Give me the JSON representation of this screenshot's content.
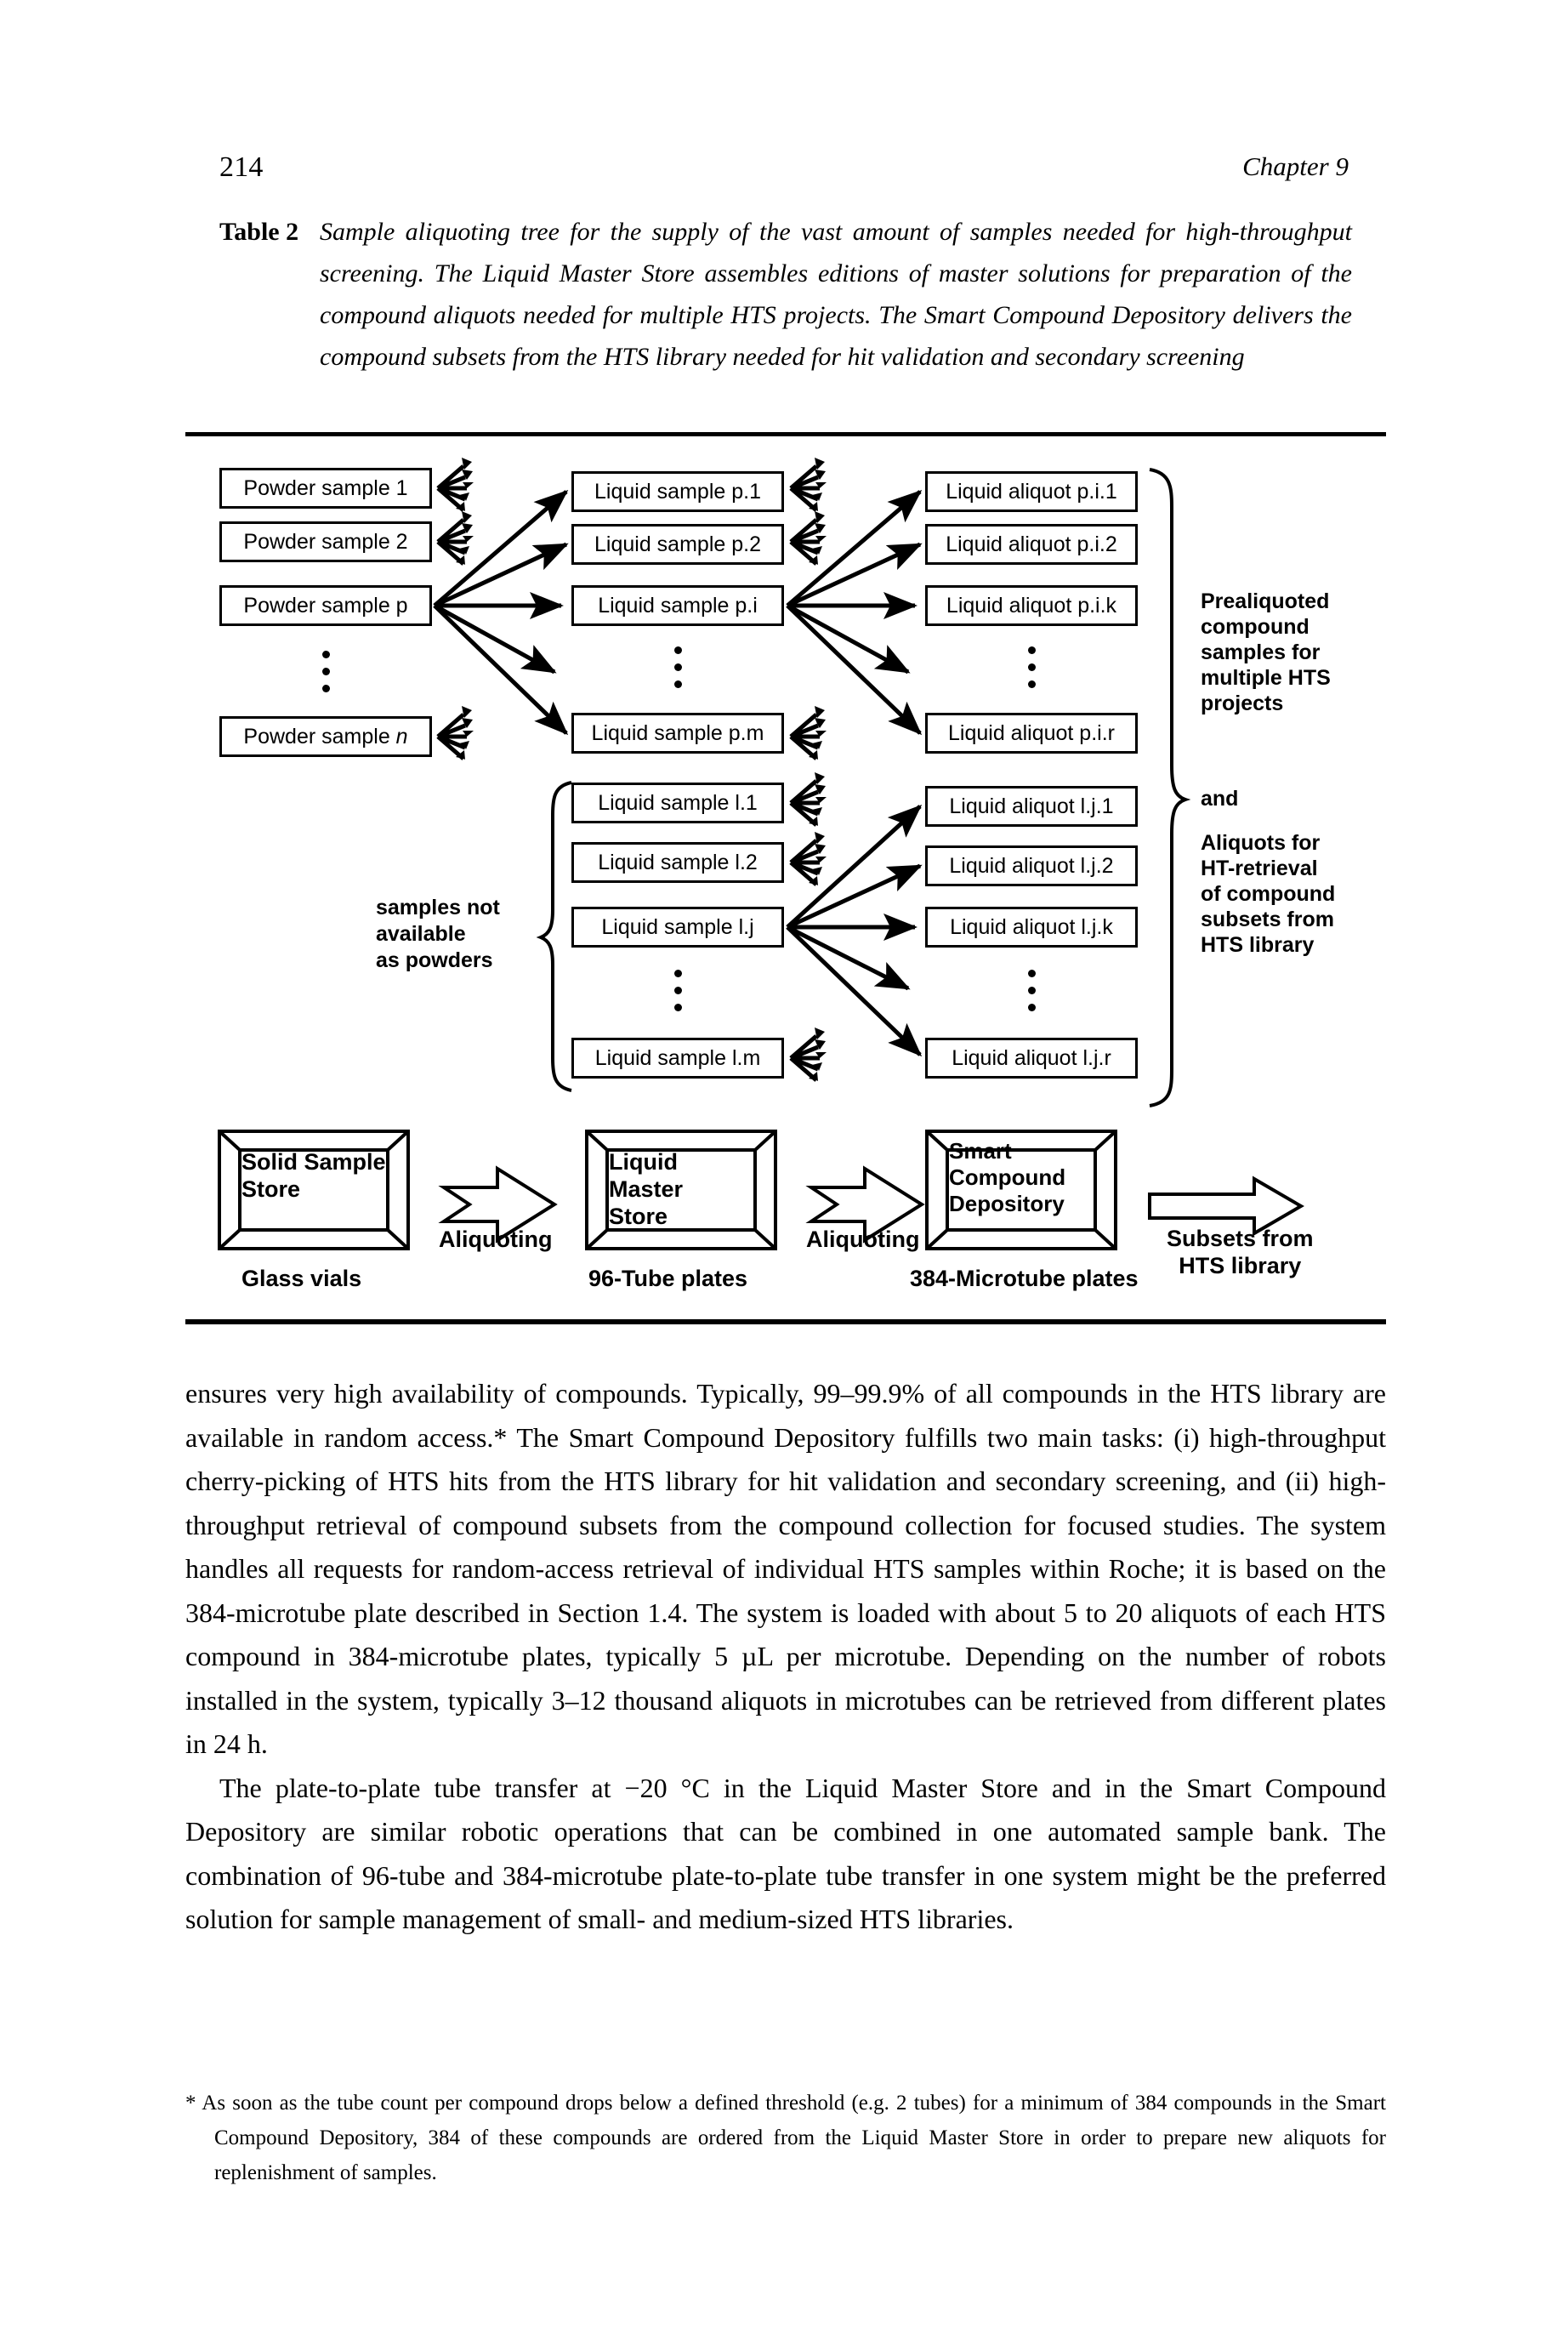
{
  "header": {
    "folio": "214",
    "chapter": "Chapter 9"
  },
  "caption": {
    "label": "Table 2",
    "text": "Sample aliquoting tree for the supply of the vast amount of samples needed for high-throughput screening. The Liquid Master Store assembles editions of master solutions for preparation of the compound aliquots needed for multiple HTS projects. The Smart Compound Depository delivers the compound subsets from the HTS library needed for hit validation and secondary screening"
  },
  "diagram": {
    "column1": {
      "nodes": [
        "Powder sample 1",
        "Powder sample 2",
        "Powder sample p",
        "Powder sample n"
      ],
      "italic_suffix_last": "n"
    },
    "column2_upper": [
      "Liquid sample p.1",
      "Liquid sample p.2",
      "Liquid sample p.i",
      "Liquid sample p.m"
    ],
    "column2_lower": [
      "Liquid sample l.1",
      "Liquid sample l.2",
      "Liquid sample l.j",
      "Liquid sample l.m"
    ],
    "column3_upper": [
      "Liquid aliquot p.i.1",
      "Liquid aliquot p.i.2",
      "Liquid aliquot p.i.k",
      "Liquid aliquot p.i.r"
    ],
    "column3_lower": [
      "Liquid aliquot l.j.1",
      "Liquid aliquot l.j.2",
      "Liquid aliquot l.j.k",
      "Liquid aliquot l.j.r"
    ],
    "annotation_right_top": "Prealiquoted\ncompound\nsamples for\nmultiple HTS\nprojects",
    "annotation_right_and": "and",
    "annotation_right_bottom": "Aliquots for\nHT-retrieval\nof compound\nsubsets from\nHTS library",
    "annotation_left": "samples not\navailable\nas powders"
  },
  "workflow": {
    "stores": [
      {
        "title": "Solid Sample\nStore",
        "caption": "Glass vials"
      },
      {
        "title": "Liquid Master\nStore",
        "caption": "96-Tube plates"
      },
      {
        "title": "Smart\nCompound\nDepository",
        "caption": "384-Microtube plates"
      }
    ],
    "arrow1_label": "Aliquoting",
    "arrow2_label": "Aliquoting",
    "arrow3_label": "Subsets from\nHTS library"
  },
  "body": {
    "paragraph1": "ensures very high availability of compounds. Typically, 99–99.9% of all compounds in the HTS library are available in random access.* The Smart Compound Depository fulfills two main tasks: (i) high-throughput cherry-picking of HTS hits from the HTS library for hit validation and secondary screening, and (ii) high-throughput retrieval of compound subsets from the compound collection for focused studies. The system handles all requests for random-access retrieval of individual HTS samples within Roche; it is based on the 384-microtube plate described in Section 1.4. The system is loaded with about 5 to 20 aliquots of each HTS compound in 384-microtube plates, typically 5 µL per microtube. Depending on the number of robots installed in the system, typically 3–12 thousand aliquots in microtubes can be retrieved from different plates in 24 h.",
    "paragraph2": "The plate-to-plate tube transfer at −20 °C in the Liquid Master Store and in the Smart Compound Depository are similar robotic operations that can be combined in one automated sample bank. The combination of 96-tube and 384-microtube plate-to-plate tube transfer in one system might be the preferred solution for sample management of small- and medium-sized HTS libraries."
  },
  "footnote": {
    "marker": "*",
    "text": "As soon as the tube count per compound drops below a defined threshold (e.g. 2 tubes) for a minimum of 384 compounds in the Smart Compound Depository, 384 of these compounds are ordered from the Liquid Master Store in order to prepare new aliquots for replenishment of samples."
  }
}
